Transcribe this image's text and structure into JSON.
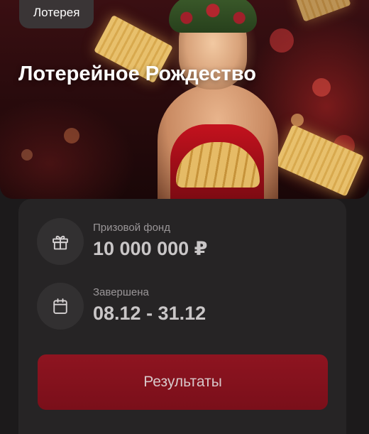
{
  "badge": {
    "label": "Лотерея"
  },
  "banner": {
    "title": "Лотерейное Рождество"
  },
  "prize": {
    "label": "Призовой фонд",
    "value": "10 000 000 ₽",
    "icon": "gift-icon"
  },
  "period": {
    "label": "Завершена",
    "value": "08.12 - 31.12",
    "icon": "calendar-icon"
  },
  "actions": {
    "results_label": "Результаты"
  },
  "colors": {
    "background": "#1c1a1b",
    "panel": "#262425",
    "accent": "#8e1420"
  }
}
